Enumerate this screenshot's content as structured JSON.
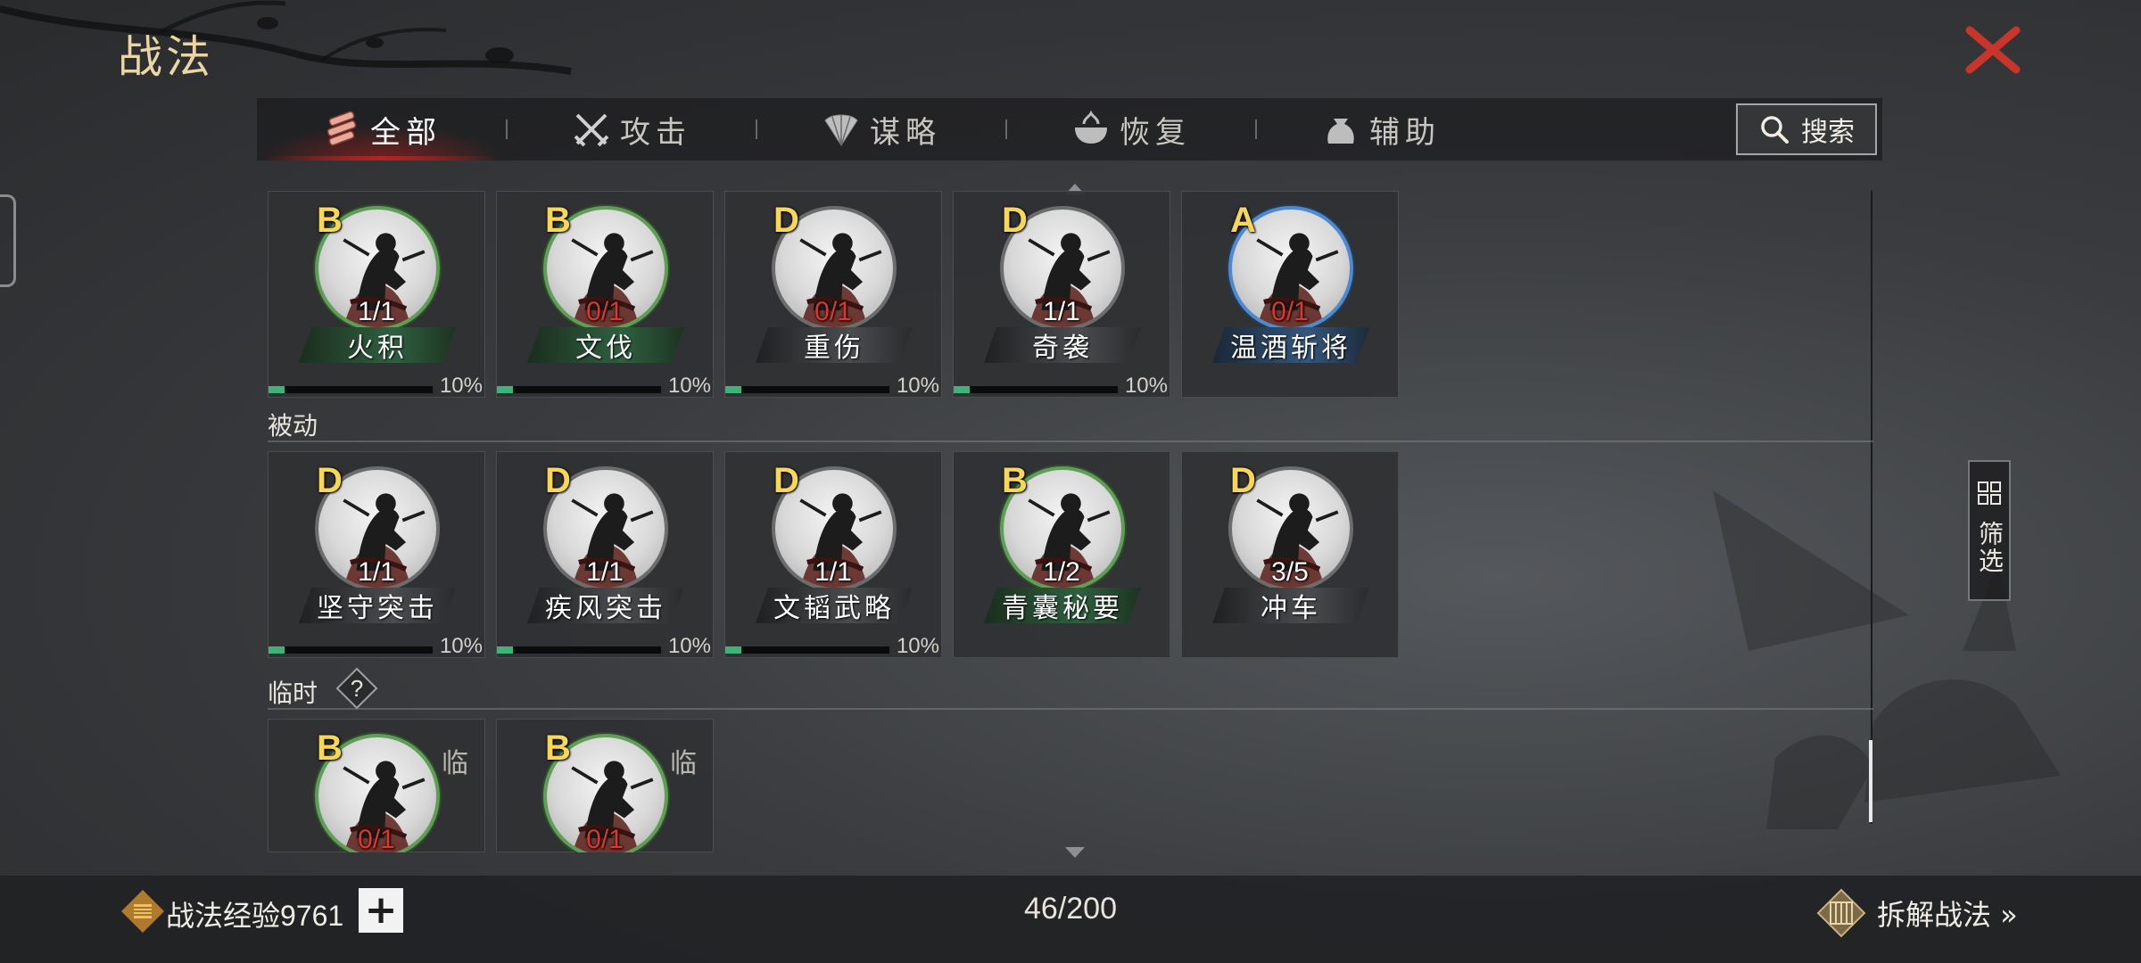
{
  "page_title": "战法",
  "tabs": [
    {
      "label": "全部",
      "icon": "scroll-bundle-icon",
      "active": true
    },
    {
      "label": "攻击",
      "icon": "crossed-swords-icon",
      "active": false
    },
    {
      "label": "谋略",
      "icon": "fan-icon",
      "active": false
    },
    {
      "label": "恢复",
      "icon": "medicine-bowl-icon",
      "active": false
    },
    {
      "label": "辅助",
      "icon": "pouch-icon",
      "active": false
    }
  ],
  "search": {
    "label": "搜索"
  },
  "sections": {
    "passive": {
      "label": "被动"
    },
    "temporary": {
      "label": "临时",
      "help_icon": "question-icon"
    }
  },
  "skills_active": [
    {
      "grade": "B",
      "count": "1/1",
      "count_red": false,
      "name": "火积",
      "quality": "green",
      "progress": "10%",
      "progress_value": 0.1
    },
    {
      "grade": "B",
      "count": "0/1",
      "count_red": true,
      "name": "文伐",
      "quality": "green",
      "progress": "10%",
      "progress_value": 0.1
    },
    {
      "grade": "D",
      "count": "0/1",
      "count_red": true,
      "name": "重伤",
      "quality": "gray",
      "progress": "10%",
      "progress_value": 0.1
    },
    {
      "grade": "D",
      "count": "1/1",
      "count_red": false,
      "name": "奇袭",
      "quality": "gray",
      "progress": "10%",
      "progress_value": 0.1
    },
    {
      "grade": "A",
      "count": "0/1",
      "count_red": true,
      "name": "温酒斩将",
      "quality": "blue",
      "progress": "",
      "progress_value": null
    }
  ],
  "skills_passive": [
    {
      "grade": "D",
      "count": "1/1",
      "count_red": false,
      "name": "坚守突击",
      "quality": "gray",
      "progress": "10%",
      "progress_value": 0.1
    },
    {
      "grade": "D",
      "count": "1/1",
      "count_red": false,
      "name": "疾风突击",
      "quality": "gray",
      "progress": "10%",
      "progress_value": 0.1
    },
    {
      "grade": "D",
      "count": "1/1",
      "count_red": false,
      "name": "文韬武略",
      "quality": "gray",
      "progress": "10%",
      "progress_value": 0.1
    },
    {
      "grade": "B",
      "count": "1/2",
      "count_red": false,
      "name": "青囊秘要",
      "quality": "green",
      "progress": "",
      "progress_value": null
    },
    {
      "grade": "D",
      "count": "3/5",
      "count_red": false,
      "name": "冲车",
      "quality": "gray",
      "progress": "",
      "progress_value": null
    }
  ],
  "skills_temporary": [
    {
      "grade": "B",
      "count": "0/1",
      "count_red": true,
      "temp_mark": "临",
      "quality": "green"
    },
    {
      "grade": "B",
      "count": "0/1",
      "count_red": true,
      "temp_mark": "临",
      "quality": "green"
    }
  ],
  "filter": {
    "label": "筛选"
  },
  "bottom": {
    "exp_label": "战法经验9761",
    "plus_label": "+",
    "capacity": "46/200",
    "dismantle_label": "拆解战法 »"
  },
  "colors": {
    "grade_gold": "#f7d65a",
    "count_red": "#e0362c",
    "progress_green": "#3fb27a",
    "tab_accent_red": "#c0201a",
    "title_gold": "#e9d6a4"
  }
}
